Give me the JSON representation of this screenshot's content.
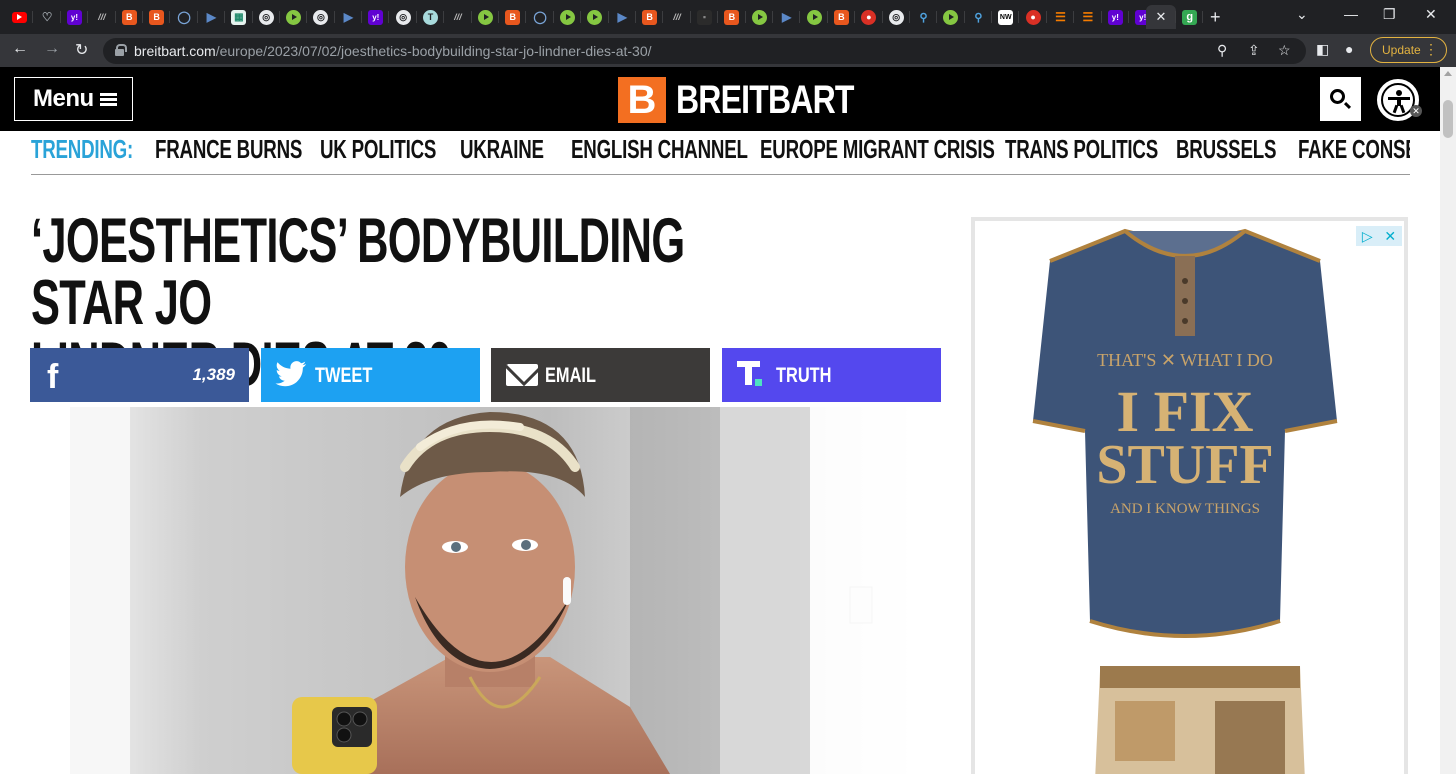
{
  "browser": {
    "tabs": [
      {
        "icon": "youtube-icon",
        "glyph": ""
      },
      {
        "icon": "heart-icon",
        "glyph": "♡"
      },
      {
        "icon": "yahoo-icon",
        "glyph": "y!"
      },
      {
        "icon": "wiki-icon",
        "glyph": "///"
      },
      {
        "icon": "breitbart-icon",
        "glyph": "B"
      },
      {
        "icon": "breitbart-icon",
        "glyph": "B"
      },
      {
        "icon": "shield-icon",
        "glyph": "◯"
      },
      {
        "icon": "flag-icon",
        "glyph": "▶"
      },
      {
        "icon": "qr-icon",
        "glyph": "▦"
      },
      {
        "icon": "globe-icon",
        "glyph": "◎"
      },
      {
        "icon": "rumble-icon",
        "glyph": ""
      },
      {
        "icon": "globe-icon",
        "glyph": "◎"
      },
      {
        "icon": "flag-icon",
        "glyph": "▶"
      },
      {
        "icon": "yahoo-icon",
        "glyph": "y!"
      },
      {
        "icon": "globe-icon",
        "glyph": "◎"
      },
      {
        "icon": "circle-icon",
        "glyph": "T"
      },
      {
        "icon": "wiki-icon",
        "glyph": "///"
      },
      {
        "icon": "rumble-icon",
        "glyph": ""
      },
      {
        "icon": "breitbart-icon",
        "glyph": "B"
      },
      {
        "icon": "shield-icon",
        "glyph": "◯"
      },
      {
        "icon": "rumble-icon",
        "glyph": ""
      },
      {
        "icon": "rumble-icon",
        "glyph": ""
      },
      {
        "icon": "flag-icon",
        "glyph": "▶"
      },
      {
        "icon": "breitbart-icon",
        "glyph": "B"
      },
      {
        "icon": "wiki-icon",
        "glyph": "///"
      },
      {
        "icon": "dark-icon",
        "glyph": "▪"
      },
      {
        "icon": "breitbart-icon",
        "glyph": "B"
      },
      {
        "icon": "rumble-icon",
        "glyph": ""
      },
      {
        "icon": "flag-icon",
        "glyph": "▶"
      },
      {
        "icon": "rumble-icon",
        "glyph": ""
      },
      {
        "icon": "breitbart-icon",
        "glyph": "B"
      },
      {
        "icon": "mic-icon",
        "glyph": "●"
      },
      {
        "icon": "globe-icon",
        "glyph": "◎"
      },
      {
        "icon": "search-icon",
        "glyph": "⚲"
      },
      {
        "icon": "rumble-icon",
        "glyph": ""
      },
      {
        "icon": "search-icon",
        "glyph": "⚲"
      },
      {
        "icon": "news-icon",
        "glyph": "NW"
      },
      {
        "icon": "mic-icon",
        "glyph": "●"
      },
      {
        "icon": "bookmark-icon",
        "glyph": "☰"
      },
      {
        "icon": "bookmark-icon",
        "glyph": "☰"
      },
      {
        "icon": "yahoo-icon",
        "glyph": "y!"
      },
      {
        "icon": "yahoo-icon",
        "glyph": "y!"
      }
    ],
    "active_tab_close": "✕",
    "extra_tab_glyph": "g",
    "new_tab": "+",
    "url_host": "breitbart.com",
    "url_path": "/europe/2023/07/02/joesthetics-bodybuilding-star-jo-lindner-dies-at-30/",
    "update_label": "Update"
  },
  "site": {
    "menu_label": "Menu",
    "logo_mark": "B",
    "logo_text": "BREITBART",
    "trending_label": "TRENDING:",
    "trending": [
      "FRANCE BURNS",
      "UK POLITICS",
      "UKRAINE",
      "ENGLISH CHANNEL",
      "EUROPE MIGRANT CRISIS",
      "TRANS POLITICS",
      "BRUSSELS",
      "FAKE CONSERV"
    ]
  },
  "article": {
    "headline_line1": "‘JOESTHETICS’ BODYBUILDING STAR JO",
    "headline_line2": "LINDNER DIES AT 30",
    "share": {
      "facebook_count": "1,389",
      "tweet_label": "TWEET",
      "email_label": "EMAIL",
      "truth_label": "TRUTH"
    }
  },
  "ad": {
    "shirt_line1": "THAT'S ✕ WHAT I DO",
    "shirt_line2": "I FIX",
    "shirt_line3": "STUFF",
    "shirt_line4": "AND I KNOW THINGS"
  },
  "colors": {
    "facebook": "#3b5998",
    "twitter": "#1da1f2",
    "email": "#3c3a39",
    "truth": "#5448ee",
    "trending_accent": "#2aa3d8",
    "breitbart_orange": "#f36f21"
  }
}
